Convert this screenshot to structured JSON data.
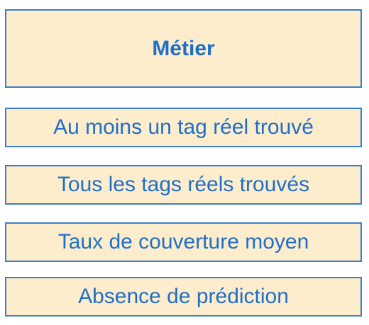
{
  "header": {
    "title": "Métier"
  },
  "items": [
    {
      "label": "Au moins un tag réel trouvé"
    },
    {
      "label": "Tous les tags réels trouvés"
    },
    {
      "label": "Taux de couverture moyen"
    },
    {
      "label": "Absence de prédiction"
    }
  ],
  "colors": {
    "box_fill": "#fdedcc",
    "box_border": "#3b7fc6",
    "text": "#1f6fc8"
  }
}
